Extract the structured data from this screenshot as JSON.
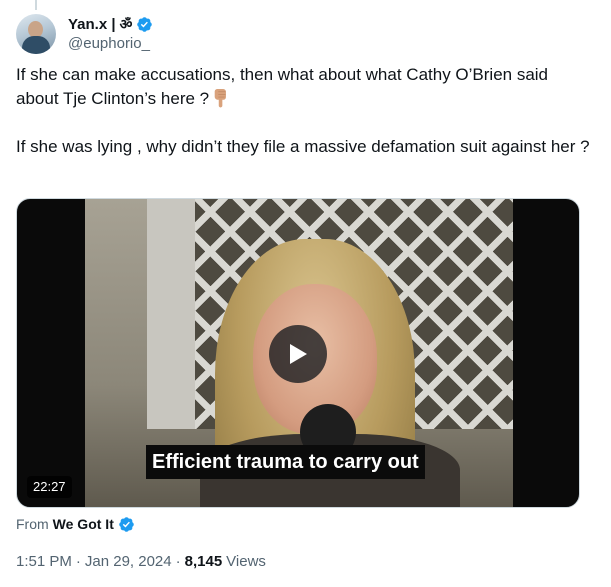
{
  "author": {
    "display_name": "Yan.x | ",
    "name_symbol": "ॐ",
    "handle": "@euphorio_",
    "avatar_icon": "user-avatar",
    "verified_icon": "verified-badge-icon"
  },
  "tweet": {
    "text_line1": "If she can make accusations, then what about what Cathy O’Brien said about Tje Clinton’s here ?",
    "emoji_icon": "backhand-index-pointing-down-icon",
    "text_line2": "If she was lying , why didn’t they file a massive defamation suit against her ?"
  },
  "media": {
    "caption": "Efficient trauma to carry out",
    "duration": "22:27",
    "play_icon": "play-icon"
  },
  "source": {
    "prefix": "From",
    "name": "We Got It",
    "verified_icon": "verified-badge-icon"
  },
  "meta": {
    "time": "1:51 PM",
    "separator": "·",
    "date": "Jan 29, 2024",
    "separator2": "·",
    "views_count": "8,145",
    "views_label": "Views"
  },
  "colors": {
    "verified_blue": "#1d9bf0",
    "secondary_text": "#536471",
    "primary_text": "#0f1419"
  }
}
